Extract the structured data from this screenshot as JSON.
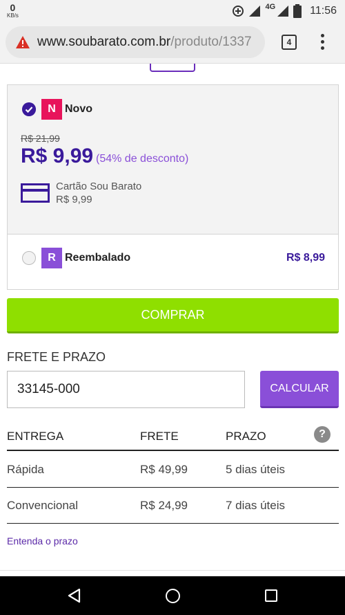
{
  "status_bar": {
    "speed_value": "0",
    "speed_unit": "KB/s",
    "network": "4G",
    "time": "11:56"
  },
  "browser": {
    "url_host": "www.soubarato.com.br",
    "url_path": "/produto/1337",
    "tab_count": "4"
  },
  "offers": {
    "new": {
      "badge": "N",
      "title": "Novo",
      "old_price": "R$ 21,99",
      "price": "R$ 9,99",
      "discount": "(54% de desconto)",
      "card_label": "Cartão Sou Barato",
      "card_price": "R$ 9,99",
      "selected": true
    },
    "repackaged": {
      "badge": "R",
      "title": "Reembalado",
      "price": "R$ 8,99",
      "selected": false
    }
  },
  "buy_button": "COMPRAR",
  "shipping": {
    "title": "FRETE E PRAZO",
    "cep_value": "33145-000",
    "calculate_button": "CALCULAR",
    "help": "?",
    "columns": [
      "ENTREGA",
      "FRETE",
      "PRAZO"
    ],
    "rows": [
      [
        "Rápida",
        "R$ 49,99",
        "5 dias úteis"
      ],
      [
        "Convencional",
        "R$ 24,99",
        "7 dias úteis"
      ]
    ],
    "link": "Entenda o prazo"
  },
  "colors": {
    "primary_purple": "#3a1a9b",
    "accent_purple": "#8a4fd8",
    "buy_green": "#8fdf00",
    "badge_new": "#e8145b"
  },
  "icons": {
    "security_warning": "warning-triangle-icon",
    "menu": "more-vert-icon",
    "help": "help-circle-icon",
    "card": "credit-card-icon"
  }
}
